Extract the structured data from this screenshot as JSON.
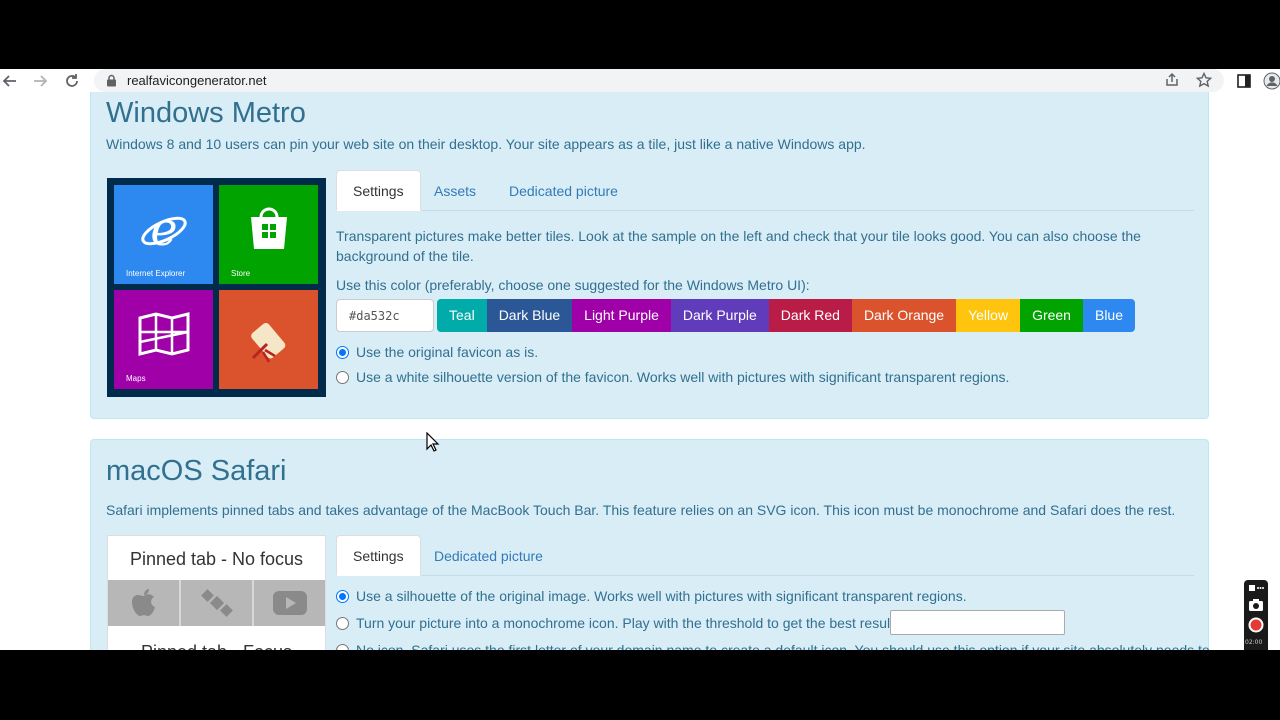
{
  "browser": {
    "url": "realfavicongenerator.net"
  },
  "metro": {
    "title": "Windows Metro",
    "description": "Windows 8 and 10 users can pin your web site on their desktop. Your site appears as a tile, just like a native Windows app.",
    "tiles": [
      {
        "label": "Internet Explorer",
        "color": "#2d89ef"
      },
      {
        "label": "Store",
        "color": "#00a300"
      },
      {
        "label": "Maps",
        "color": "#9f00a7"
      },
      {
        "label": "",
        "color": "#da532c"
      }
    ],
    "tabs": [
      {
        "label": "Settings",
        "active": true
      },
      {
        "label": "Assets",
        "active": false
      },
      {
        "label": "Dedicated picture",
        "active": false
      }
    ],
    "intro_text": "Transparent pictures make better tiles. Look at the sample on the left and check that your tile looks good. You can also choose the background of the tile.",
    "color_prompt": "Use this color (preferably, choose one suggested for the Windows Metro UI):",
    "color_value": "#da532c",
    "swatches": [
      {
        "label": "Teal",
        "color": "#00aba9",
        "text": "#ffffff"
      },
      {
        "label": "Dark Blue",
        "color": "#2b5797",
        "text": "#ffffff"
      },
      {
        "label": "Light Purple",
        "color": "#9f00a7",
        "text": "#ffffff"
      },
      {
        "label": "Dark Purple",
        "color": "#603cba",
        "text": "#ffffff"
      },
      {
        "label": "Dark Red",
        "color": "#b91d47",
        "text": "#ffffff"
      },
      {
        "label": "Dark Orange",
        "color": "#da532c",
        "text": "#ffffff"
      },
      {
        "label": "Yellow",
        "color": "#ffc40d",
        "text": "#ffffff"
      },
      {
        "label": "Green",
        "color": "#00a300",
        "text": "#ffffff"
      },
      {
        "label": "Blue",
        "color": "#2d89ef",
        "text": "#ffffff"
      }
    ],
    "radio_original": "Use the original favicon as is.",
    "radio_silhouette": "Use a white silhouette version of the favicon. Works well with pictures with significant transparent regions."
  },
  "safari": {
    "title": "macOS Safari",
    "description": "Safari implements pinned tabs and takes advantage of the MacBook Touch Bar. This feature relies on an SVG icon. This icon must be monochrome and Safari does the rest.",
    "pinned_no_focus": "Pinned tab - No focus",
    "pinned_focus": "Pinned tab - Focus",
    "tabs": [
      {
        "label": "Settings",
        "active": true
      },
      {
        "label": "Dedicated picture",
        "active": false
      }
    ],
    "radio_silhouette": "Use a silhouette of the original image. Works well with pictures with significant transparent regions.",
    "radio_monochrome": "Turn your picture into a monochrome icon. Play with the threshold to get the best result.",
    "radio_no_icon": "No icon. Safari uses the first letter of your domain name to create a default icon. You should use this option if your site absolutely needs to"
  },
  "recorder": {
    "time": "02:00"
  },
  "colors": {
    "panel_bg": "#d9edf7",
    "panel_text": "#31708f",
    "link": "#337ab7"
  }
}
